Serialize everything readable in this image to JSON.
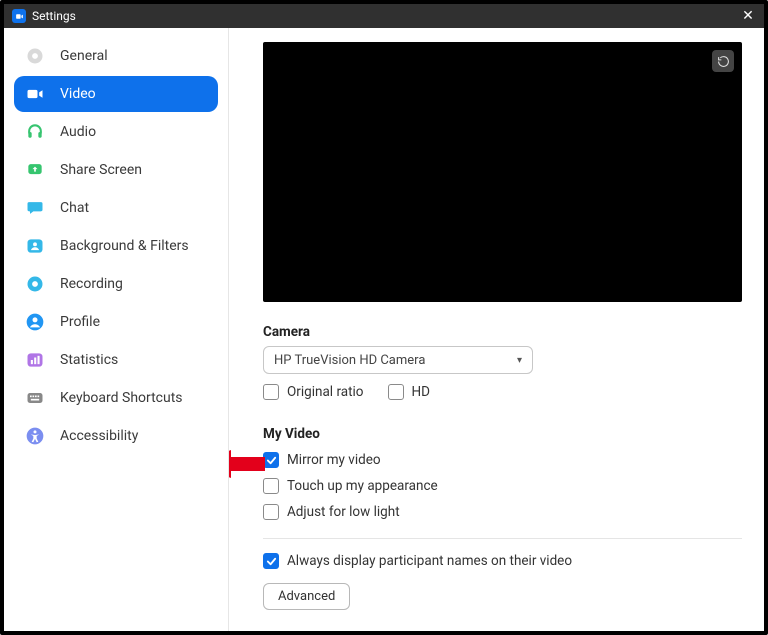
{
  "title": "Settings",
  "sidebar": {
    "items": [
      {
        "label": "General"
      },
      {
        "label": "Video"
      },
      {
        "label": "Audio"
      },
      {
        "label": "Share Screen"
      },
      {
        "label": "Chat"
      },
      {
        "label": "Background & Filters"
      },
      {
        "label": "Recording"
      },
      {
        "label": "Profile"
      },
      {
        "label": "Statistics"
      },
      {
        "label": "Keyboard Shortcuts"
      },
      {
        "label": "Accessibility"
      }
    ]
  },
  "camera": {
    "heading": "Camera",
    "selected": "HP TrueVision HD Camera",
    "opts": {
      "original_ratio": "Original ratio",
      "hd": "HD"
    }
  },
  "my_video": {
    "heading": "My Video",
    "mirror": "Mirror my video",
    "touch_up": "Touch up my appearance",
    "low_light": "Adjust for low light"
  },
  "participants": {
    "always_display": "Always display participant names on their video"
  },
  "advanced_label": "Advanced"
}
